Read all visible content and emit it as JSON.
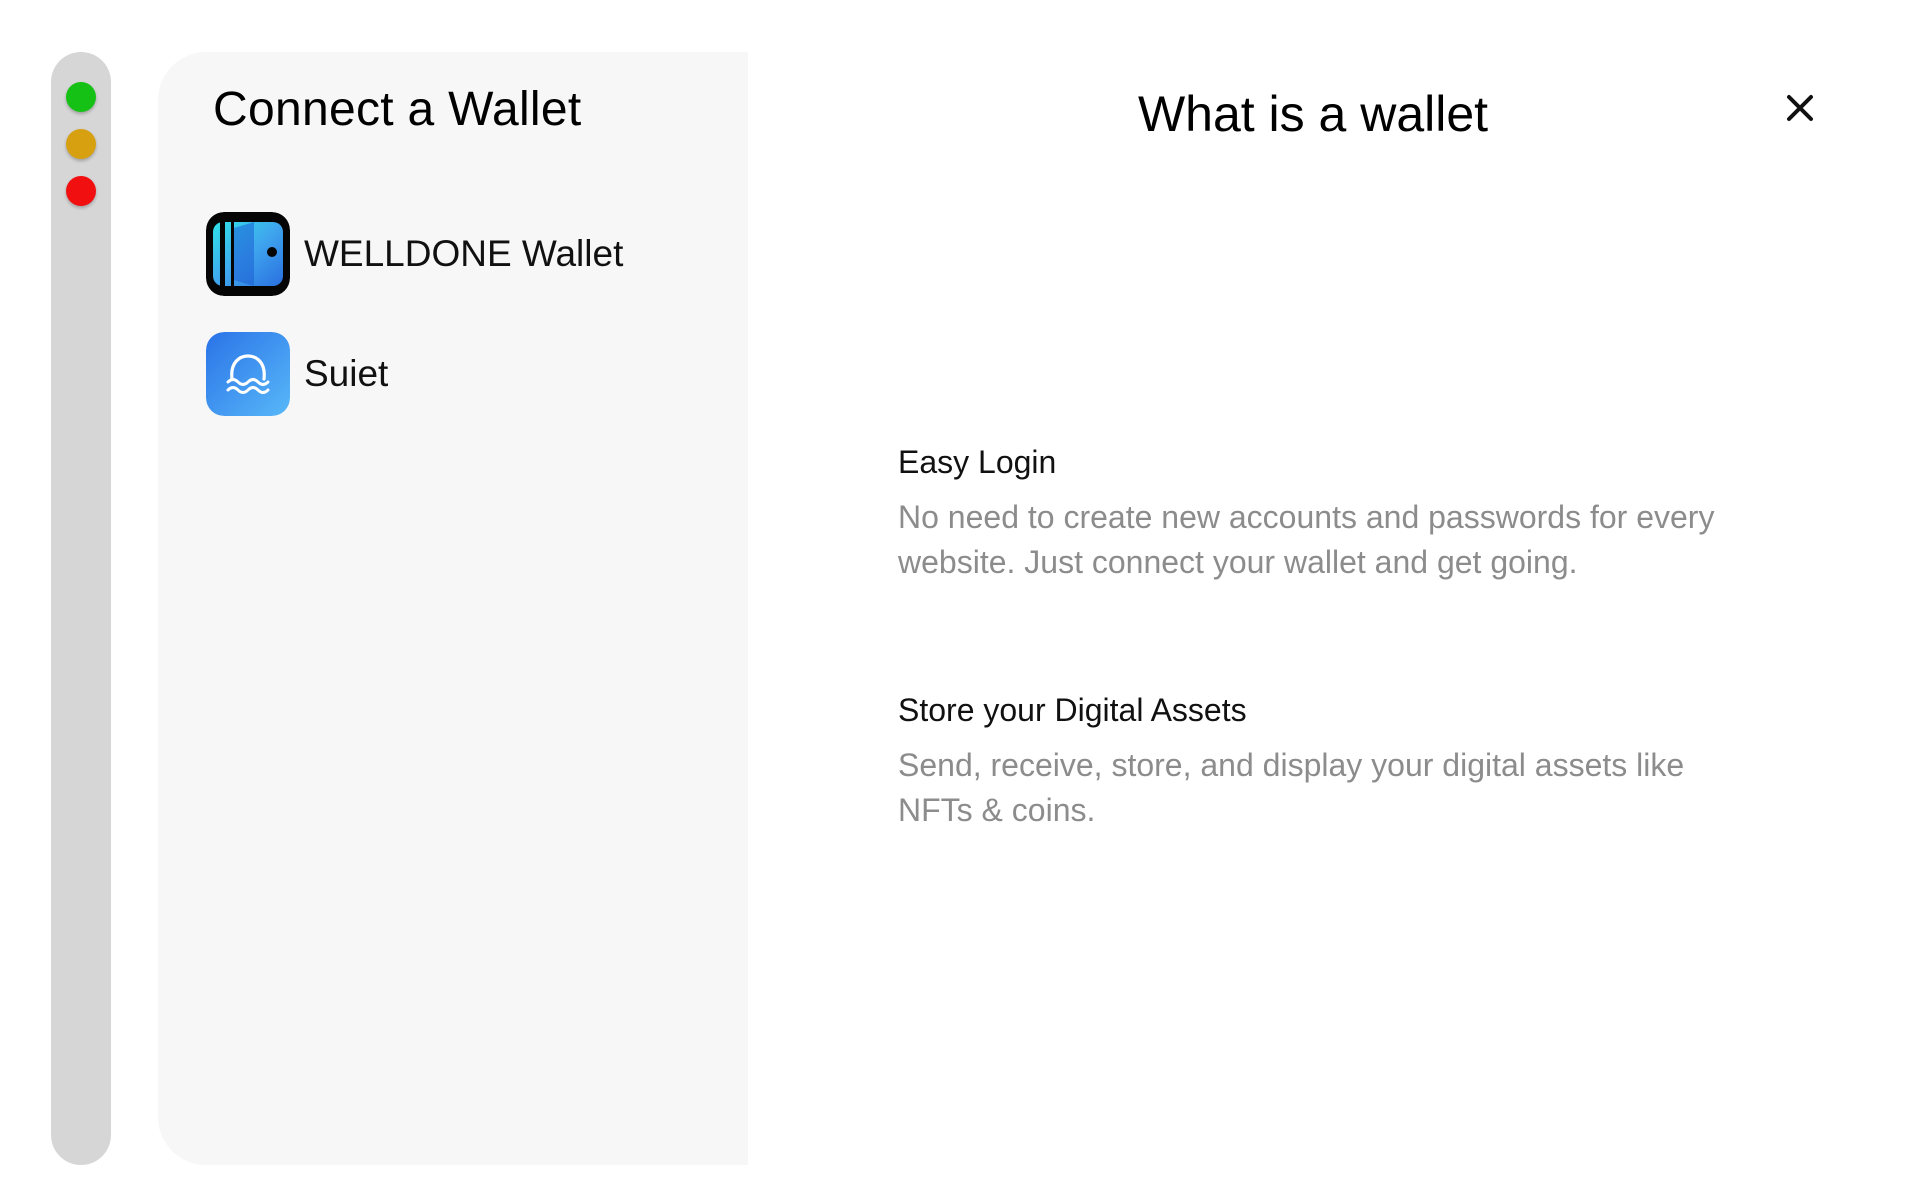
{
  "colors": {
    "traffic_green": "#16c116",
    "traffic_yellow": "#d7a011",
    "traffic_red": "#f20f0f",
    "left_panel_bg": "#f6f7f6",
    "muted_text": "#8c8c8c"
  },
  "left": {
    "title": "Connect a Wallet",
    "wallets": [
      {
        "name": "WELLDONE Wallet",
        "icon": "welldone-wallet-icon"
      },
      {
        "name": "Suiet",
        "icon": "suiet-wallet-icon"
      }
    ]
  },
  "right": {
    "title": "What is a wallet",
    "close_icon": "close-icon",
    "sections": [
      {
        "heading": "Easy Login",
        "text": "No need to create new accounts and passwords for every website. Just connect your wallet and get going."
      },
      {
        "heading": "Store your Digital Assets",
        "text": "Send, receive, store, and display your digital assets like NFTs & coins."
      }
    ]
  }
}
